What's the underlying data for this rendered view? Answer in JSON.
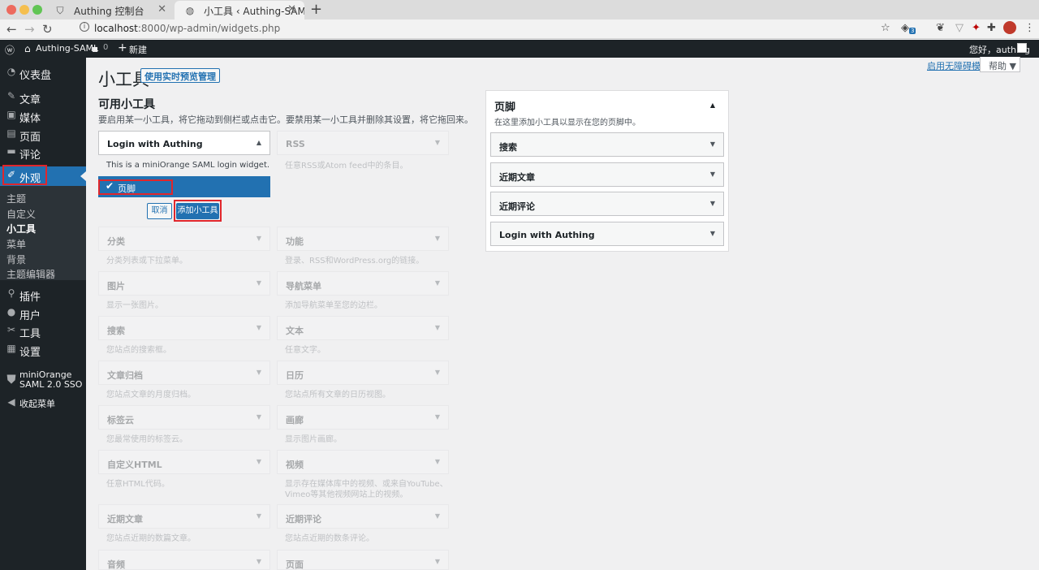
{
  "browser": {
    "tabs": [
      {
        "title": "Authing 控制台",
        "icon": "shield-icon",
        "active": false
      },
      {
        "title": "小工具 ‹ Authing-SAML —",
        "icon": "globe-icon",
        "active": true
      }
    ],
    "new_tab": "+",
    "url_host": "localhost",
    "url_rest": ":8000/wp-admin/widgets.php",
    "ext_badge": "3"
  },
  "admin_bar": {
    "site_name": "Authing-SAML",
    "comments_count": "0",
    "new_label": "新建",
    "greeting": "您好，authing"
  },
  "sidebar": {
    "items": [
      {
        "label": "仪表盘",
        "icon": "dashboard-icon"
      },
      {
        "label": "文章",
        "icon": "pin-icon"
      },
      {
        "label": "媒体",
        "icon": "media-icon"
      },
      {
        "label": "页面",
        "icon": "page-icon"
      },
      {
        "label": "评论",
        "icon": "comment-icon"
      },
      {
        "label": "外观",
        "icon": "brush-icon"
      },
      {
        "label": "插件",
        "icon": "plugin-icon"
      },
      {
        "label": "用户",
        "icon": "user-icon"
      },
      {
        "label": "工具",
        "icon": "wrench-icon"
      },
      {
        "label": "设置",
        "icon": "settings-icon"
      },
      {
        "label": "miniOrange SAML 2.0 SSO",
        "icon": "shield-icon"
      },
      {
        "label": "收起菜单",
        "icon": "collapse-icon"
      }
    ],
    "submenu": [
      "主题",
      "自定义",
      "小工具",
      "菜单",
      "背景",
      "主题编辑器"
    ]
  },
  "header": {
    "a11y_link": "启用无障碍模式",
    "help": "帮助 ▼",
    "title": "小工具",
    "preview_button": "使用实时预览管理"
  },
  "available": {
    "title": "可用小工具",
    "desc": "要启用某一小工具，将它拖动到侧栏或点击它。要禁用某一小工具并删除其设置，将它拖回来。",
    "active_widget": "Login with Authing",
    "active_desc": "This is a miniOrange SAML login widget.",
    "chooser_selected": "页脚",
    "cancel": "取消",
    "add": "添加小工具",
    "widgets": [
      {
        "title": "RSS",
        "desc": "任意RSS或Atom feed中的条目。"
      },
      {
        "title": "分类",
        "desc": "分类列表或下拉菜单。"
      },
      {
        "title": "功能",
        "desc": "登录、RSS和WordPress.org的链接。"
      },
      {
        "title": "图片",
        "desc": "显示一张图片。"
      },
      {
        "title": "导航菜单",
        "desc": "添加导航菜单至您的边栏。"
      },
      {
        "title": "搜索",
        "desc": "您站点的搜索框。"
      },
      {
        "title": "文本",
        "desc": "任意文字。"
      },
      {
        "title": "文章归档",
        "desc": "您站点文章的月度归档。"
      },
      {
        "title": "日历",
        "desc": "您站点所有文章的日历视图。"
      },
      {
        "title": "标签云",
        "desc": "您最常使用的标签云。"
      },
      {
        "title": "画廊",
        "desc": "显示图片画廊。"
      },
      {
        "title": "自定义HTML",
        "desc": "任意HTML代码。"
      },
      {
        "title": "视频",
        "desc": "显示存在媒体库中的视频、或来自YouTube、Vimeo等其他视频网站上的视频。"
      },
      {
        "title": "近期文章",
        "desc": "您站点近期的数篇文章。"
      },
      {
        "title": "近期评论",
        "desc": "您站点近期的数条评论。"
      },
      {
        "title": "音频",
        "desc": ""
      },
      {
        "title": "页面",
        "desc": ""
      }
    ]
  },
  "footer_area": {
    "title": "页脚",
    "desc": "在这里添加小工具以显示在您的页脚中。",
    "widgets": [
      "搜索",
      "近期文章",
      "近期评论",
      "Login with Authing"
    ]
  },
  "colors": {
    "wp_blue": "#2271b1",
    "admin_dark": "#1d2327",
    "highlight_red": "#e0262c"
  }
}
